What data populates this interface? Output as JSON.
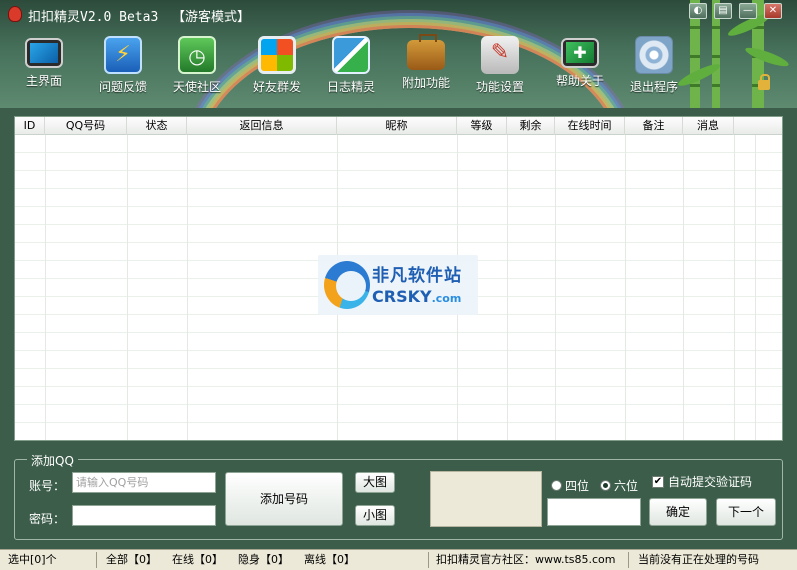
{
  "window": {
    "title": "扣扣精灵V2.0 Beta3",
    "mode": "【游客模式】",
    "controls": {
      "skin": "◐",
      "menu": "▤",
      "minimize": "—",
      "close": "✕"
    }
  },
  "toolbar": {
    "items": [
      {
        "label": "主界面",
        "icon": "monitor-icon"
      },
      {
        "label": "问题反馈",
        "icon": "feedback-shield-icon"
      },
      {
        "label": "天使社区",
        "icon": "community-shield-icon"
      },
      {
        "label": "好友群发",
        "icon": "broadcast-icon"
      },
      {
        "label": "日志精灵",
        "icon": "log-shield-icon"
      },
      {
        "label": "附加功能",
        "icon": "briefcase-icon"
      },
      {
        "label": "功能设置",
        "icon": "settings-tools-icon"
      },
      {
        "label": "帮助关于",
        "icon": "help-monitor-icon"
      },
      {
        "label": "退出程序",
        "icon": "exit-disc-icon"
      }
    ]
  },
  "table": {
    "columns": [
      "ID",
      "QQ号码",
      "状态",
      "返回信息",
      "昵称",
      "等级",
      "剩余",
      "在线时间",
      "备注",
      "消息"
    ],
    "rows": []
  },
  "watermark": {
    "cn": "非凡软件站",
    "en": "CRSKY",
    "en_suffix": ".com"
  },
  "add_panel": {
    "title": "添加QQ",
    "account_label": "账号：",
    "account_placeholder": "请输入QQ号码",
    "password_label": "密码：",
    "add_button": "添加号码",
    "big_image_button": "大图",
    "small_image_button": "小图",
    "radio_four": "四位",
    "radio_six": "六位",
    "radio_selected": "六位",
    "auto_submit_label": "自动提交验证码",
    "auto_submit_checked": true,
    "confirm_button": "确定",
    "next_button": "下一个"
  },
  "statusbar": {
    "selected": "选中[0]个",
    "all": "全部【0】",
    "online": "在线【0】",
    "invisible": "隐身【0】",
    "offline": "离线【0】",
    "community": "扣扣精灵官方社区：www.ts85.com",
    "processing": "当前没有正在处理的号码"
  }
}
